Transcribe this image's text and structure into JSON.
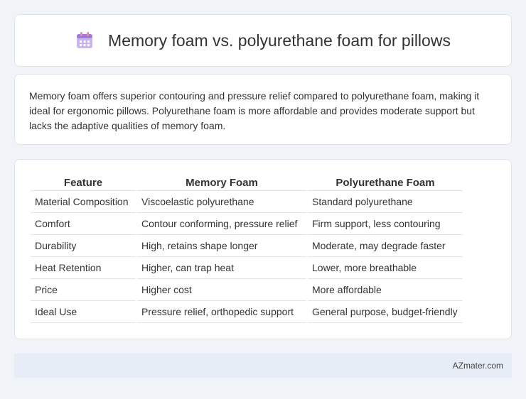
{
  "header": {
    "title": "Memory foam vs. polyurethane foam for pillows",
    "icon": "calendar-icon",
    "icon_colors": {
      "primary": "#9b7be0",
      "secondary": "#c8b5f2",
      "accent": "#ef8aa0"
    }
  },
  "summary": {
    "text": "Memory foam offers superior contouring and pressure relief compared to polyurethane foam, making it ideal for ergonomic pillows. Polyurethane foam is more affordable and provides moderate support but lacks the adaptive qualities of memory foam."
  },
  "table": {
    "headers": [
      "Feature",
      "Memory Foam",
      "Polyurethane Foam"
    ],
    "rows": [
      [
        "Material Composition",
        "Viscoelastic polyurethane",
        "Standard polyurethane"
      ],
      [
        "Comfort",
        "Contour conforming, pressure relief",
        "Firm support, less contouring"
      ],
      [
        "Durability",
        "High, retains shape longer",
        "Moderate, may degrade faster"
      ],
      [
        "Heat Retention",
        "Higher, can trap heat",
        "Lower, more breathable"
      ],
      [
        "Price",
        "Higher cost",
        "More affordable"
      ],
      [
        "Ideal Use",
        "Pressure relief, orthopedic support",
        "General purpose, budget-friendly"
      ]
    ]
  },
  "footer": {
    "text": "AZmater.com"
  }
}
